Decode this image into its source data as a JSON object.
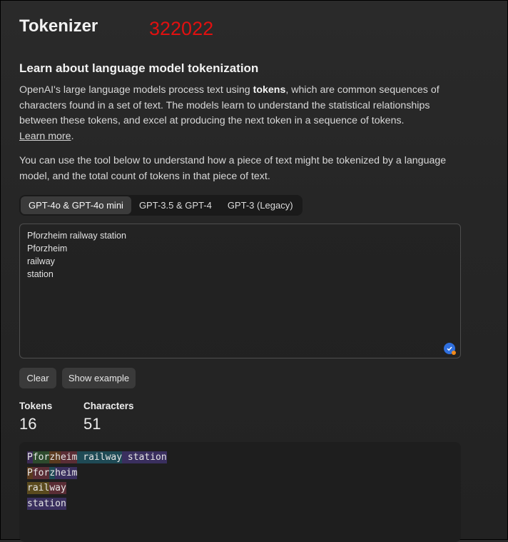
{
  "header": {
    "title": "Tokenizer",
    "overlay_number": "322022"
  },
  "intro": {
    "heading": "Learn about language model tokenization",
    "p1_part1": "OpenAI's large language models process text using ",
    "p1_bold": "tokens",
    "p1_part2": ", which are common sequences of characters found in a set of text. The models learn to understand the statistical relationships between these tokens, and excel at producing the next token in a sequence of tokens.",
    "learn_more": "Learn more",
    "learn_more_suffix": ".",
    "p2": "You can use the tool below to understand how a piece of text might be tokenized by a language model, and the total count of tokens in that piece of text."
  },
  "tabs": [
    {
      "label": "GPT-4o & GPT-4o mini",
      "active": true
    },
    {
      "label": "GPT-3.5 & GPT-4",
      "active": false
    },
    {
      "label": "GPT-3 (Legacy)",
      "active": false
    }
  ],
  "input": {
    "lines": [
      "Pforzheim railway station",
      "Pforzheim",
      "railway",
      "station"
    ]
  },
  "buttons": {
    "clear": "Clear",
    "show_example": "Show example"
  },
  "stats": {
    "tokens_label": "Tokens",
    "tokens_value": "16",
    "characters_label": "Characters",
    "characters_value": "51"
  },
  "token_view": {
    "lines": [
      [
        {
          "text": "P",
          "color": "#3b2a55"
        },
        {
          "text": "for",
          "color": "#2d4a2d"
        },
        {
          "text": "zh",
          "color": "#5a3a1e"
        },
        {
          "text": "eim",
          "color": "#5a2d35"
        },
        {
          "text": " railway",
          "color": "#1f4a55"
        },
        {
          "text": " station",
          "color": "#3a2f5e"
        }
      ],
      [
        {
          "text": "P",
          "color": "#5a3a1e"
        },
        {
          "text": "for",
          "color": "#5a2d35"
        },
        {
          "text": "z",
          "color": "#1f4a55"
        },
        {
          "text": "heim",
          "color": "#3a2f5e"
        }
      ],
      [
        {
          "text": "rail",
          "color": "#5a4a1e"
        },
        {
          "text": "way",
          "color": "#5a2d35"
        }
      ],
      [
        {
          "text": "station",
          "color": "#3a2f5e"
        }
      ]
    ]
  }
}
